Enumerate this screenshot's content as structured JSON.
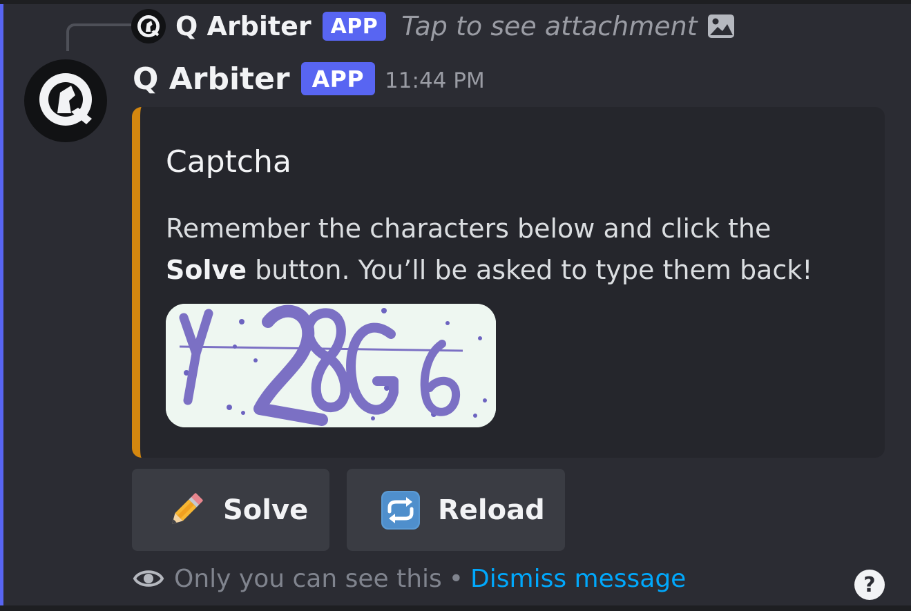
{
  "reply": {
    "author": "Q Arbiter",
    "badge": "APP",
    "preview": "Tap to see attachment",
    "icon": "image-icon"
  },
  "message": {
    "author": "Q Arbiter",
    "badge": "APP",
    "timestamp": "11:44 PM",
    "avatar_icon": "q-knight-logo",
    "accent_color": "#5865f2"
  },
  "embed": {
    "title": "Captcha",
    "description_line1": "Remember the characters below and click the",
    "description_bold": "Solve",
    "description_line2": " button. You’ll be asked to type them back!",
    "accent_color": "#d4870f",
    "captcha_image": {
      "characters_shown": "Y28G6"
    }
  },
  "buttons": [
    {
      "label": "Solve",
      "icon": "pencil-icon"
    },
    {
      "label": "Reload",
      "icon": "repeat-icon"
    }
  ],
  "footer": {
    "notice": "Only you can see this",
    "separator": "•",
    "dismiss": "Dismiss message",
    "eye_icon": "eye-icon",
    "help_icon": "help-icon",
    "help_symbol": "?"
  }
}
